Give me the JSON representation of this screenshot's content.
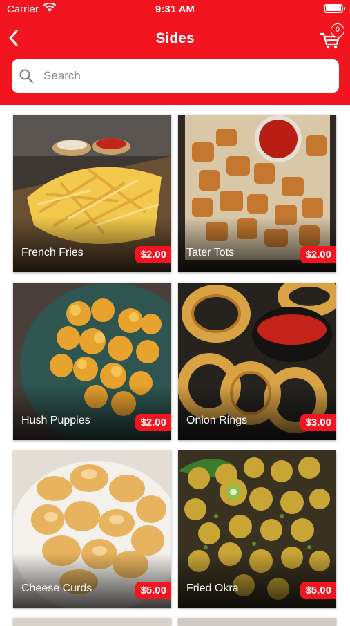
{
  "status_bar": {
    "carrier": "Carrier",
    "time": "9:31 AM"
  },
  "header": {
    "title": "Sides",
    "cart_count": "0"
  },
  "search": {
    "placeholder": "Search",
    "value": ""
  },
  "items": [
    {
      "name": "French Fries",
      "price": "$2.00"
    },
    {
      "name": "Tater Tots",
      "price": "$2.00"
    },
    {
      "name": "Hush Puppies",
      "price": "$2.00"
    },
    {
      "name": "Onion Rings",
      "price": "$3.00"
    },
    {
      "name": "Cheese Curds",
      "price": "$5.00"
    },
    {
      "name": "Fried Okra",
      "price": "$5.00"
    }
  ],
  "colors": {
    "accent": "#f2141e"
  }
}
